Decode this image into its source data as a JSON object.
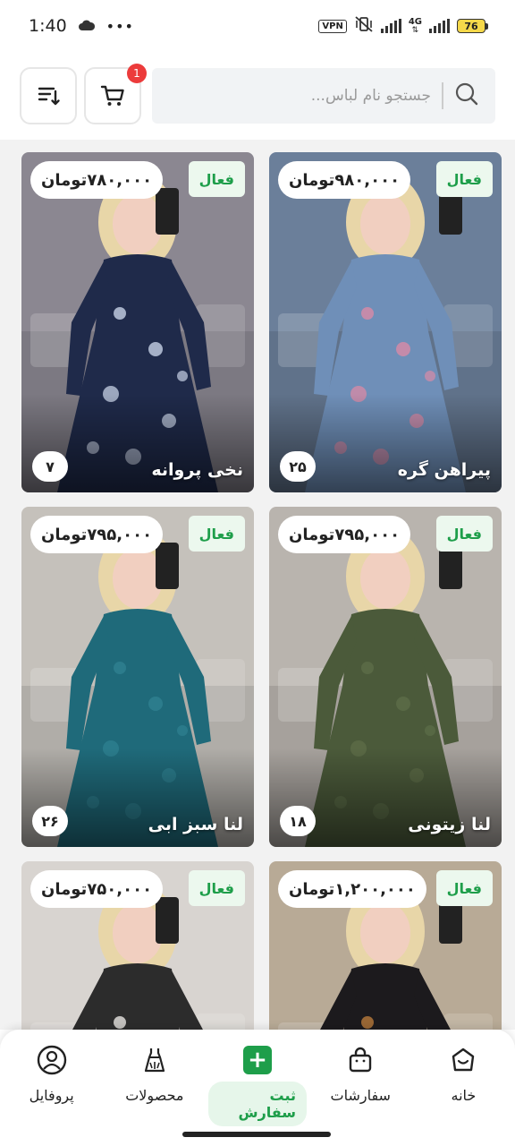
{
  "status_bar": {
    "time": "1:40",
    "vpn": "VPN",
    "network": "4G",
    "battery": "76"
  },
  "header": {
    "search_placeholder": "جستجو نام لباس...",
    "cart_count": "1"
  },
  "products": [
    {
      "name": "پیراهن گره",
      "price": "۹۸۰,۰۰۰تومان",
      "status": "فعال",
      "count": "۲۵",
      "colors": {
        "bg": "#6b7f9a",
        "dress": "#6f8fb8",
        "accent": "#d98aa6"
      }
    },
    {
      "name": "نخی پروانه",
      "price": "۷۸۰,۰۰۰تومان",
      "status": "فعال",
      "count": "۷",
      "colors": {
        "bg": "#8b8791",
        "dress": "#1f2a4a",
        "accent": "#c7d2e6"
      }
    },
    {
      "name": "لنا زیتونی",
      "price": "۷۹۵,۰۰۰تومان",
      "status": "فعال",
      "count": "۱۸",
      "colors": {
        "bg": "#b9b4ae",
        "dress": "#4b5a3a",
        "accent": "#5d6d48"
      }
    },
    {
      "name": "لنا سبز ابی",
      "price": "۷۹۵,۰۰۰تومان",
      "status": "فعال",
      "count": "۲۶",
      "colors": {
        "bg": "#c5c1bb",
        "dress": "#1f6a7a",
        "accent": "#2f8191"
      }
    },
    {
      "name": "",
      "price": "۱,۲۰۰,۰۰۰تومان",
      "status": "فعال",
      "count": "",
      "colors": {
        "bg": "#b8aa96",
        "dress": "#1c1a1d",
        "accent": "#b97a3c"
      }
    },
    {
      "name": "",
      "price": "۷۵۰,۰۰۰تومان",
      "status": "فعال",
      "count": "",
      "colors": {
        "bg": "#d8d4d0",
        "dress": "#2c2c2c",
        "accent": "#e9e6e2"
      }
    }
  ],
  "bottom_nav": [
    {
      "label": "خانه",
      "icon": "home-icon"
    },
    {
      "label": "سفارشات",
      "icon": "shopping-bag-icon"
    },
    {
      "label": "ثبت سفارش",
      "icon": "plus-icon",
      "active": true
    },
    {
      "label": "محصولات",
      "icon": "dress-icon"
    },
    {
      "label": "پروفایل",
      "icon": "user-icon"
    }
  ],
  "colors": {
    "accent_green": "#1e9e4a",
    "badge_red": "#ec3b3b"
  }
}
